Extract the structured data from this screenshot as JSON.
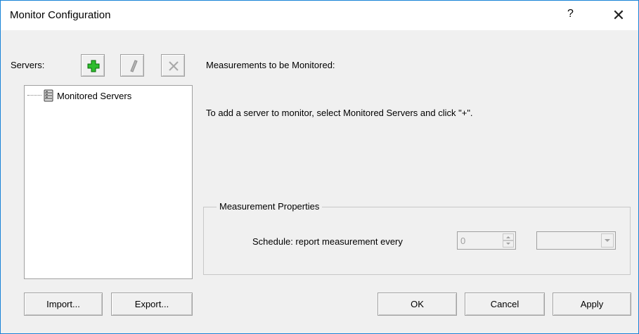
{
  "window": {
    "title": "Monitor Configuration",
    "help_label": "?",
    "close_label": "✕"
  },
  "servers": {
    "label": "Servers:",
    "toolbar": {
      "add_icon": "plus-icon",
      "edit_icon": "pencil-icon",
      "delete_icon": "x-icon",
      "add_color": "#2ebd2e"
    },
    "tree": {
      "items": [
        {
          "label": "Monitored Servers",
          "icon": "server-database-icon"
        }
      ]
    }
  },
  "measurements": {
    "heading": "Measurements to be Monitored:",
    "hint": "To add a server to monitor, select Monitored Servers and click \"+\"."
  },
  "properties": {
    "group_label": "Measurement Properties",
    "schedule_label": "Schedule: report measurement every",
    "interval_value": "0",
    "unit_value": ""
  },
  "buttons": {
    "import_label": "Import...",
    "export_label": "Export...",
    "ok_label": "OK",
    "cancel_label": "Cancel",
    "apply_label": "Apply"
  }
}
